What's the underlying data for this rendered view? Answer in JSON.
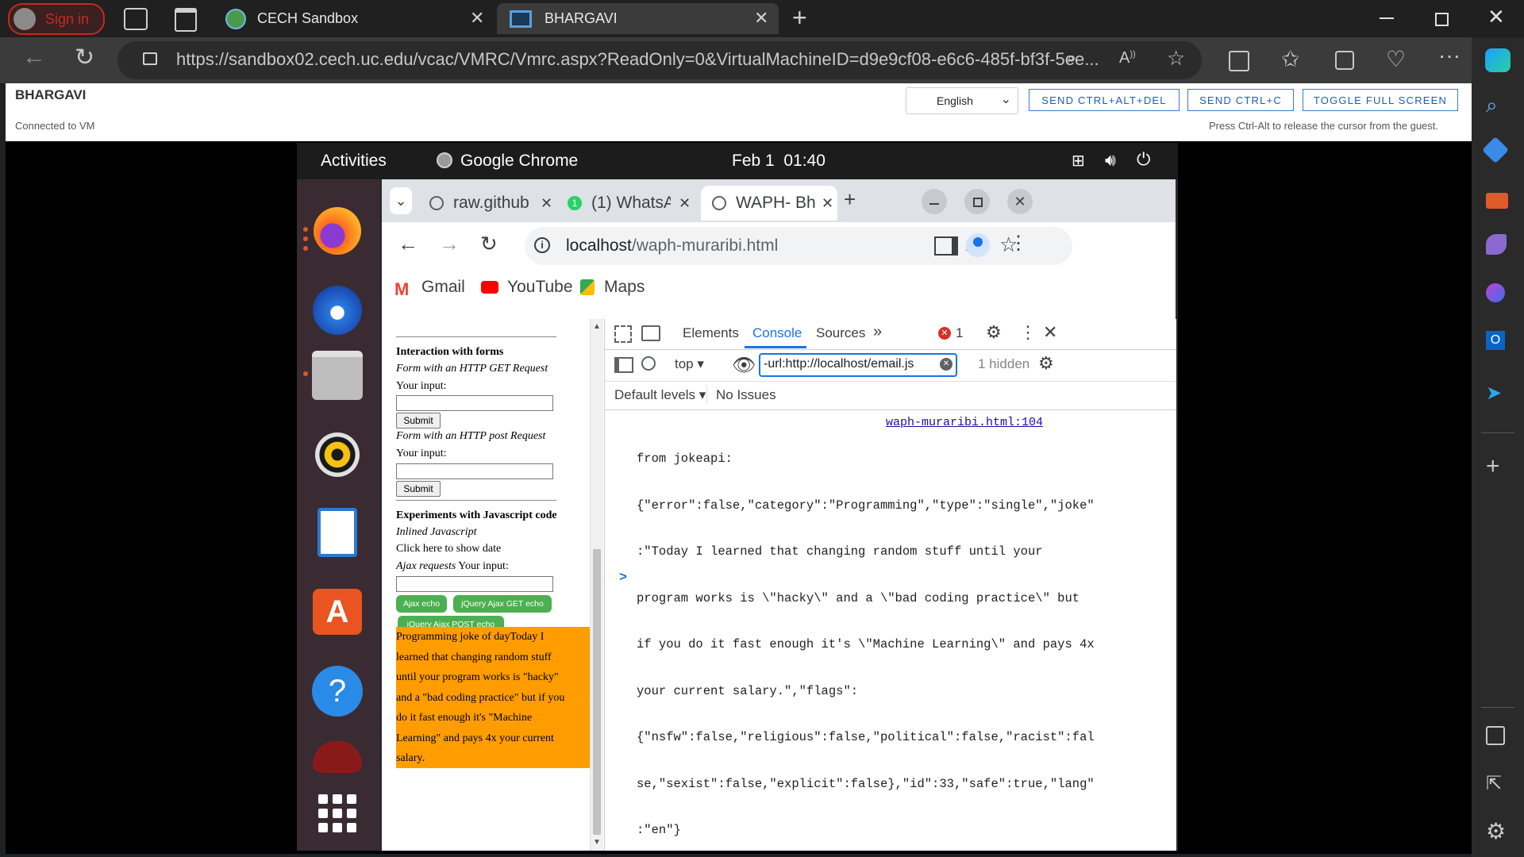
{
  "edge": {
    "signin_label": "Sign in",
    "tabs": [
      {
        "title": "CECH Sandbox"
      },
      {
        "title": "BHARGAVI"
      }
    ],
    "url": "https://sandbox02.cech.uc.edu/vcac/VMRC/Vmrc.aspx?ReadOnly=0&VirtualMachineID=d9e9cf08-e6c6-485f-bf3f-5ee..."
  },
  "vmrc": {
    "vm_name": "BHARGAVI",
    "status": "Connected to VM",
    "language_selected": "English",
    "buttons": [
      "SEND CTRL+ALT+DEL",
      "SEND CTRL+C",
      "TOGGLE FULL SCREEN"
    ],
    "hint": "Press Ctrl-Alt to release the cursor from the guest."
  },
  "ubuntu": {
    "activities": "Activities",
    "app_name": "Google Chrome",
    "clock": "Feb 1  01:40"
  },
  "chrome": {
    "tabs": [
      {
        "title": "raw.github"
      },
      {
        "title": "(1) WhatsA"
      },
      {
        "title": "WAPH- Bha"
      }
    ],
    "whatsapp_badge": "1",
    "url_host": "localhost",
    "url_path": "/waph-muraribi.html",
    "bookmarks": [
      "Gmail",
      "YouTube",
      "Maps"
    ]
  },
  "webpage": {
    "forms_heading": "Interaction with forms",
    "get_form_label": "Form with an HTTP GET Request",
    "your_input": "Your input:",
    "submit": "Submit",
    "post_form_label": "Form with an HTTP post Request",
    "js_heading": "Experiments with Javascript code",
    "inline_js": "Inlined Javascript",
    "show_date": "Click here to show date",
    "ajax_label_italic": "Ajax requests",
    "ajax_label_rest": " Your input:",
    "green_buttons": [
      "Ajax echo",
      "jQuery Ajax GET echo",
      "jQuery Ajax POST echo"
    ],
    "joke_lines": [
      "Programming joke of dayToday I",
      "learned that changing random stuff",
      "until your program works is \"hacky\"",
      "and a \"bad coding practice\" but if you",
      "do it fast enough it's \"Machine",
      "Learning\" and pays 4x your current",
      "salary."
    ]
  },
  "devtools": {
    "tabs": [
      "Elements",
      "Console",
      "Sources"
    ],
    "active_tab": "Console",
    "error_count": "1",
    "context": "top",
    "filter_value": "-url:http://localhost/email.js",
    "hidden_count": "1 hidden",
    "levels": "Default levels",
    "issues": "No Issues",
    "message_source": "waph-muraribi.html:104",
    "message_lines": [
      "from jokeapi:",
      "{\"error\":false,\"category\":\"Programming\",\"type\":\"single\",\"joke\"",
      ":\"Today I learned that changing random stuff until your",
      "program works is \\\"hacky\\\" and a \\\"bad coding practice\\\" but",
      "if you do it fast enough it's \\\"Machine Learning\\\" and pays 4x",
      "your current salary.\",\"flags\":",
      "{\"nsfw\":false,\"religious\":false,\"political\":false,\"racist\":fal",
      "se,\"sexist\":false,\"explicit\":false},\"id\":33,\"safe\":true,\"lang\"",
      ":\"en\"}"
    ],
    "prompt": ">"
  },
  "colors": {
    "accent_blue": "#1a73e8",
    "joke_bg": "#ff9d00",
    "green_btn": "#4caf50",
    "error_red": "#d93025"
  }
}
